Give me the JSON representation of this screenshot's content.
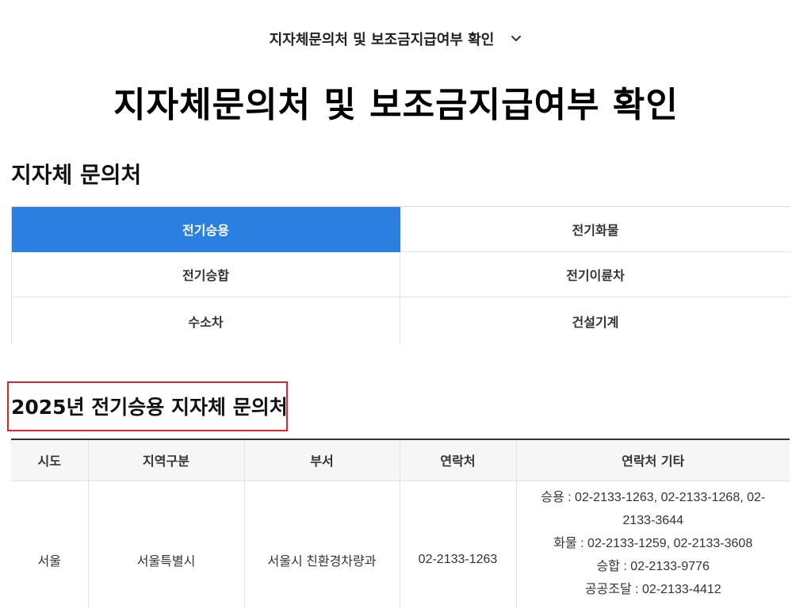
{
  "breadcrumb": {
    "label": "지자체문의처 및 보조금지급여부 확인",
    "icon": "chevron-down-icon"
  },
  "page": {
    "title": "지자체문의처 및 보조금지급여부 확인"
  },
  "section": {
    "title": "지자체 문의처"
  },
  "tabs": [
    {
      "label": "전기승용",
      "active": true
    },
    {
      "label": "전기화물",
      "active": false
    },
    {
      "label": "전기승합",
      "active": false
    },
    {
      "label": "전기이륜차",
      "active": false
    },
    {
      "label": "수소차",
      "active": false
    },
    {
      "label": "건설기계",
      "active": false
    }
  ],
  "subsection": {
    "title": "2025년 전기승용 지자체 문의처"
  },
  "table": {
    "headers": [
      "시도",
      "지역구분",
      "부서",
      "연락처",
      "연락처 기타"
    ],
    "rows": [
      {
        "sido": "서울",
        "region": "서울특별시",
        "dept": "서울시 친환경차량과",
        "phone": "02-2133-1263",
        "extra": [
          "승용 : 02-2133-1263, 02-2133-1268, 02-",
          "2133-3644",
          "화물 : 02-2133-1259, 02-2133-3608",
          "승합 : 02-2133-9776",
          "공공조달 : 02-2133-4412"
        ]
      }
    ]
  },
  "colors": {
    "accent": "#2b7fe0",
    "highlight_border": "#e0242a"
  }
}
